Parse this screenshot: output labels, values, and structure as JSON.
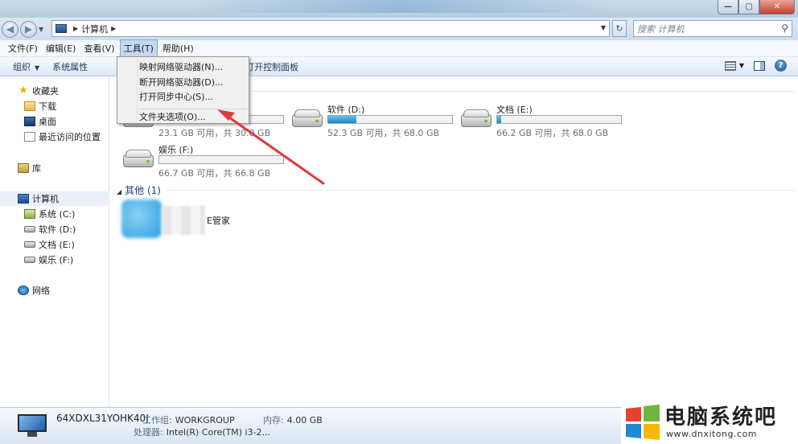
{
  "address": {
    "path": "计算机",
    "search_placeholder": "搜索 计算机"
  },
  "menubar": [
    "文件(F)",
    "编辑(E)",
    "查看(V)",
    "工具(T)",
    "帮助(H)"
  ],
  "toolbar": {
    "organize": "组织",
    "sysprops": "系统属性",
    "control_panel": "打开控制面板"
  },
  "tools_menu": {
    "items": [
      "映射网络驱动器(N)...",
      "断开网络驱动器(D)...",
      "打开同步中心(S)...",
      "文件夹选项(O)..."
    ]
  },
  "sidebar": {
    "favorites": "收藏夹",
    "downloads": "下载",
    "desktop": "桌面",
    "recent": "最近访问的位置",
    "libraries": "库",
    "computer": "计算机",
    "drives": [
      "系统 (C:)",
      "软件 (D:)",
      "文档 (E:)",
      "娱乐 (F:)"
    ],
    "network": "网络"
  },
  "drives": [
    {
      "name": "",
      "free": "23.1 GB 可用，共 30.0 GB",
      "used_fraction": 0.23
    },
    {
      "name": "软件 (D:)",
      "free": "52.3 GB 可用，共 68.0 GB",
      "used_fraction": 0.23
    },
    {
      "name": "文档 (E:)",
      "free": "66.2 GB 可用，共 68.0 GB",
      "used_fraction": 0.03
    },
    {
      "name": "娱乐 (F:)",
      "free": "66.7 GB 可用，共 66.8 GB",
      "used_fraction": 0.0
    }
  ],
  "other_group": {
    "title": "其他 (1)",
    "item_label": "E管家"
  },
  "details": {
    "pc_name": "64XDXL31YOHK40J",
    "workgroup_key": "工作组:",
    "workgroup": "WORKGROUP",
    "memory_key": "内存:",
    "memory": "4.00 GB",
    "cpu_key": "处理器:",
    "cpu": "Intel(R) Core(TM) i3-2..."
  },
  "watermark": {
    "title": "电脑系统吧",
    "url": "www.dnxitong.com"
  },
  "colors": {
    "accent": "#2e8fd0",
    "arrow": "#e03a3a"
  }
}
